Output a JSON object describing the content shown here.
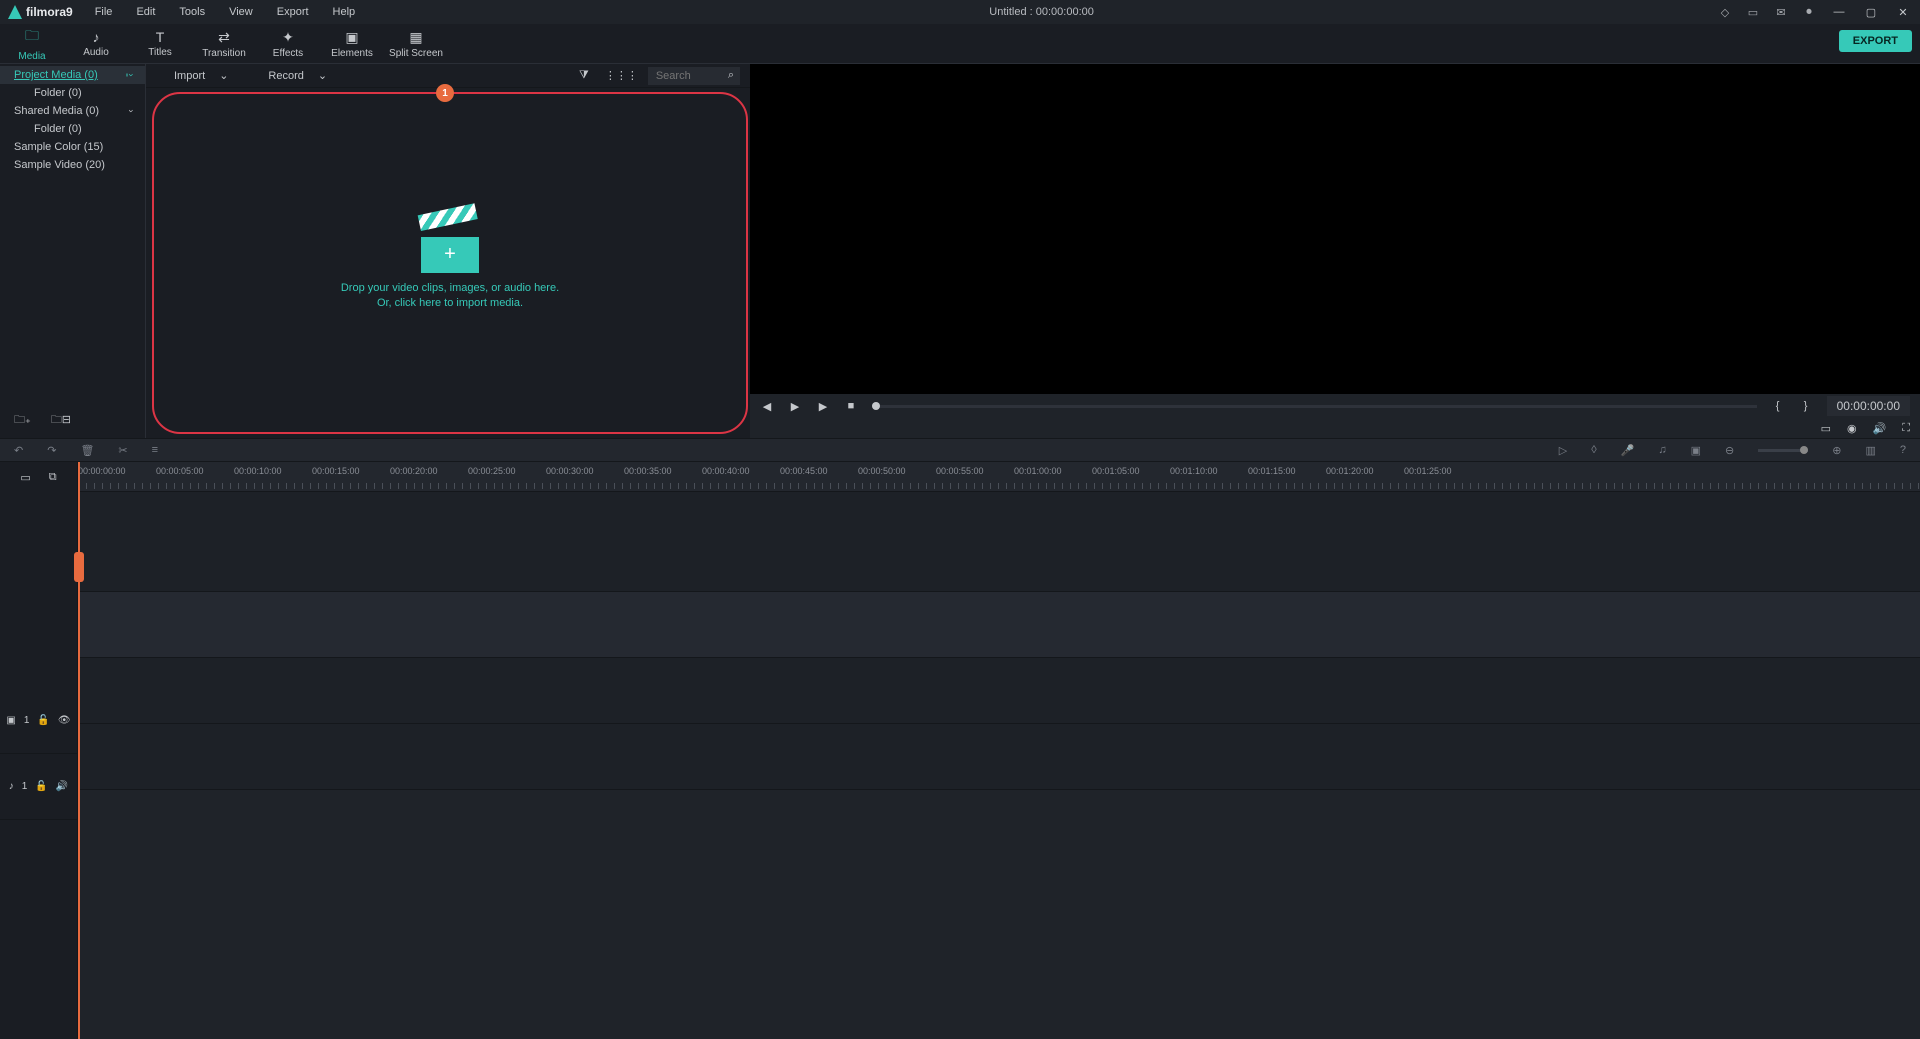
{
  "app": {
    "name": "filmora",
    "version": "9"
  },
  "menus": [
    "File",
    "Edit",
    "Tools",
    "View",
    "Export",
    "Help"
  ],
  "title": "Untitled : 00:00:00:00",
  "toolbar": {
    "tabs": [
      {
        "label": "Media",
        "icon": "folder"
      },
      {
        "label": "Audio",
        "icon": "note"
      },
      {
        "label": "Titles",
        "icon": "T"
      },
      {
        "label": "Transition",
        "icon": "swap"
      },
      {
        "label": "Effects",
        "icon": "sparkle"
      },
      {
        "label": "Elements",
        "icon": "image"
      },
      {
        "label": "Split Screen",
        "icon": "grid"
      }
    ],
    "active": 0,
    "export": "EXPORT"
  },
  "sidebar": [
    {
      "label": "Project Media (0)",
      "selected": true,
      "expandable": true
    },
    {
      "label": "Folder (0)",
      "indent": true
    },
    {
      "label": "Shared Media (0)",
      "expandable": true
    },
    {
      "label": "Folder (0)",
      "indent": true
    },
    {
      "label": "Sample Color (15)"
    },
    {
      "label": "Sample Video (20)"
    }
  ],
  "media_top": {
    "import": "Import",
    "record": "Record",
    "search_placeholder": "Search"
  },
  "drop": {
    "badge": "1",
    "line1": "Drop your video clips, images, or audio here.",
    "line2": "Or, click here to import media."
  },
  "preview": {
    "time": "00:00:00:00"
  },
  "ruler": {
    "marks": [
      "00:00:00:00",
      "00:00:05:00",
      "00:00:10:00",
      "00:00:15:00",
      "00:00:20:00",
      "00:00:25:00",
      "00:00:30:00",
      "00:00:35:00",
      "00:00:40:00",
      "00:00:45:00",
      "00:00:50:00",
      "00:00:55:00",
      "00:01:00:00",
      "00:01:05:00",
      "00:01:10:00",
      "00:01:15:00",
      "00:01:20:00",
      "00:01:25:00"
    ],
    "spacing_px": 78
  },
  "tracks": {
    "video_num": "1",
    "audio_num": "1"
  }
}
